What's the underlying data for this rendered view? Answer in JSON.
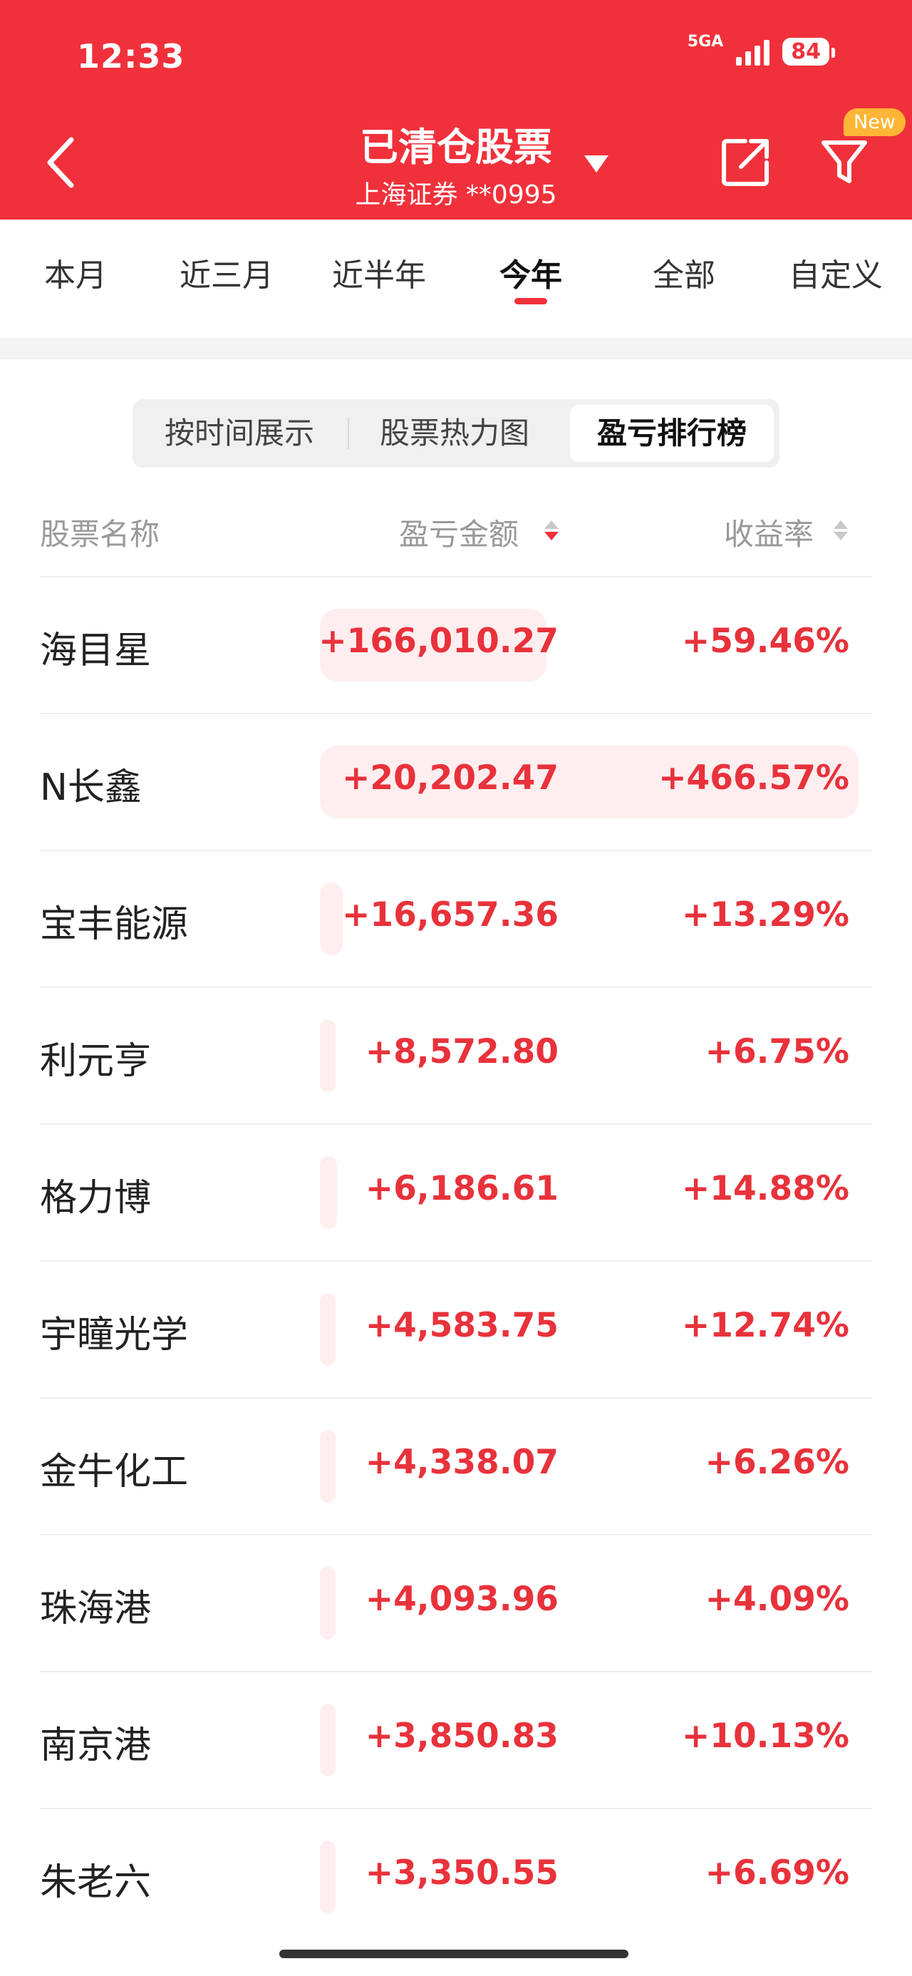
{
  "status_bar": {
    "time": "12:33",
    "network": "5GA",
    "battery": "84"
  },
  "header": {
    "title": "已清仓股票",
    "subtitle": "上海证券 **0995",
    "new_badge": "New"
  },
  "tabs": [
    {
      "label": "本月",
      "active": false
    },
    {
      "label": "近三月",
      "active": false
    },
    {
      "label": "近半年",
      "active": false
    },
    {
      "label": "今年",
      "active": true
    },
    {
      "label": "全部",
      "active": false
    },
    {
      "label": "自定义",
      "active": false
    }
  ],
  "segments": [
    {
      "label": "按时间展示",
      "active": false
    },
    {
      "label": "股票热力图",
      "active": false
    },
    {
      "label": "盈亏排行榜",
      "active": true
    }
  ],
  "columns": {
    "name": "股票名称",
    "amount": "盈亏金额",
    "rate": "收益率"
  },
  "sort": {
    "amount": "desc",
    "rate": "none"
  },
  "rows": [
    {
      "name": "海目星",
      "amount": "+166,010.27",
      "rate": "+59.46%",
      "amount_value": 166010.27,
      "rate_value": 59.46
    },
    {
      "name": "N长鑫",
      "amount": "+20,202.47",
      "rate": "+466.57%",
      "amount_value": 20202.47,
      "rate_value": 466.57
    },
    {
      "name": "宝丰能源",
      "amount": "+16,657.36",
      "rate": "+13.29%",
      "amount_value": 16657.36,
      "rate_value": 13.29
    },
    {
      "name": "利元亨",
      "amount": "+8,572.80",
      "rate": "+6.75%",
      "amount_value": 8572.8,
      "rate_value": 6.75
    },
    {
      "name": "格力博",
      "amount": "+6,186.61",
      "rate": "+14.88%",
      "amount_value": 6186.61,
      "rate_value": 14.88
    },
    {
      "name": "宇瞳光学",
      "amount": "+4,583.75",
      "rate": "+12.74%",
      "amount_value": 4583.75,
      "rate_value": 12.74
    },
    {
      "name": "金牛化工",
      "amount": "+4,338.07",
      "rate": "+6.26%",
      "amount_value": 4338.07,
      "rate_value": 6.26
    },
    {
      "name": "珠海港",
      "amount": "+4,093.96",
      "rate": "+4.09%",
      "amount_value": 4093.96,
      "rate_value": 4.09
    },
    {
      "name": "南京港",
      "amount": "+3,850.83",
      "rate": "+10.13%",
      "amount_value": 3850.83,
      "rate_value": 10.13
    },
    {
      "name": "朱老六",
      "amount": "+3,350.55",
      "rate": "+6.69%",
      "amount_value": 3350.55,
      "rate_value": 6.69
    }
  ],
  "colors": {
    "brand_red": "#f0313b",
    "bar_tint": "#ffeeef",
    "value_red": "#e8323b",
    "badge": "#ffb637"
  }
}
